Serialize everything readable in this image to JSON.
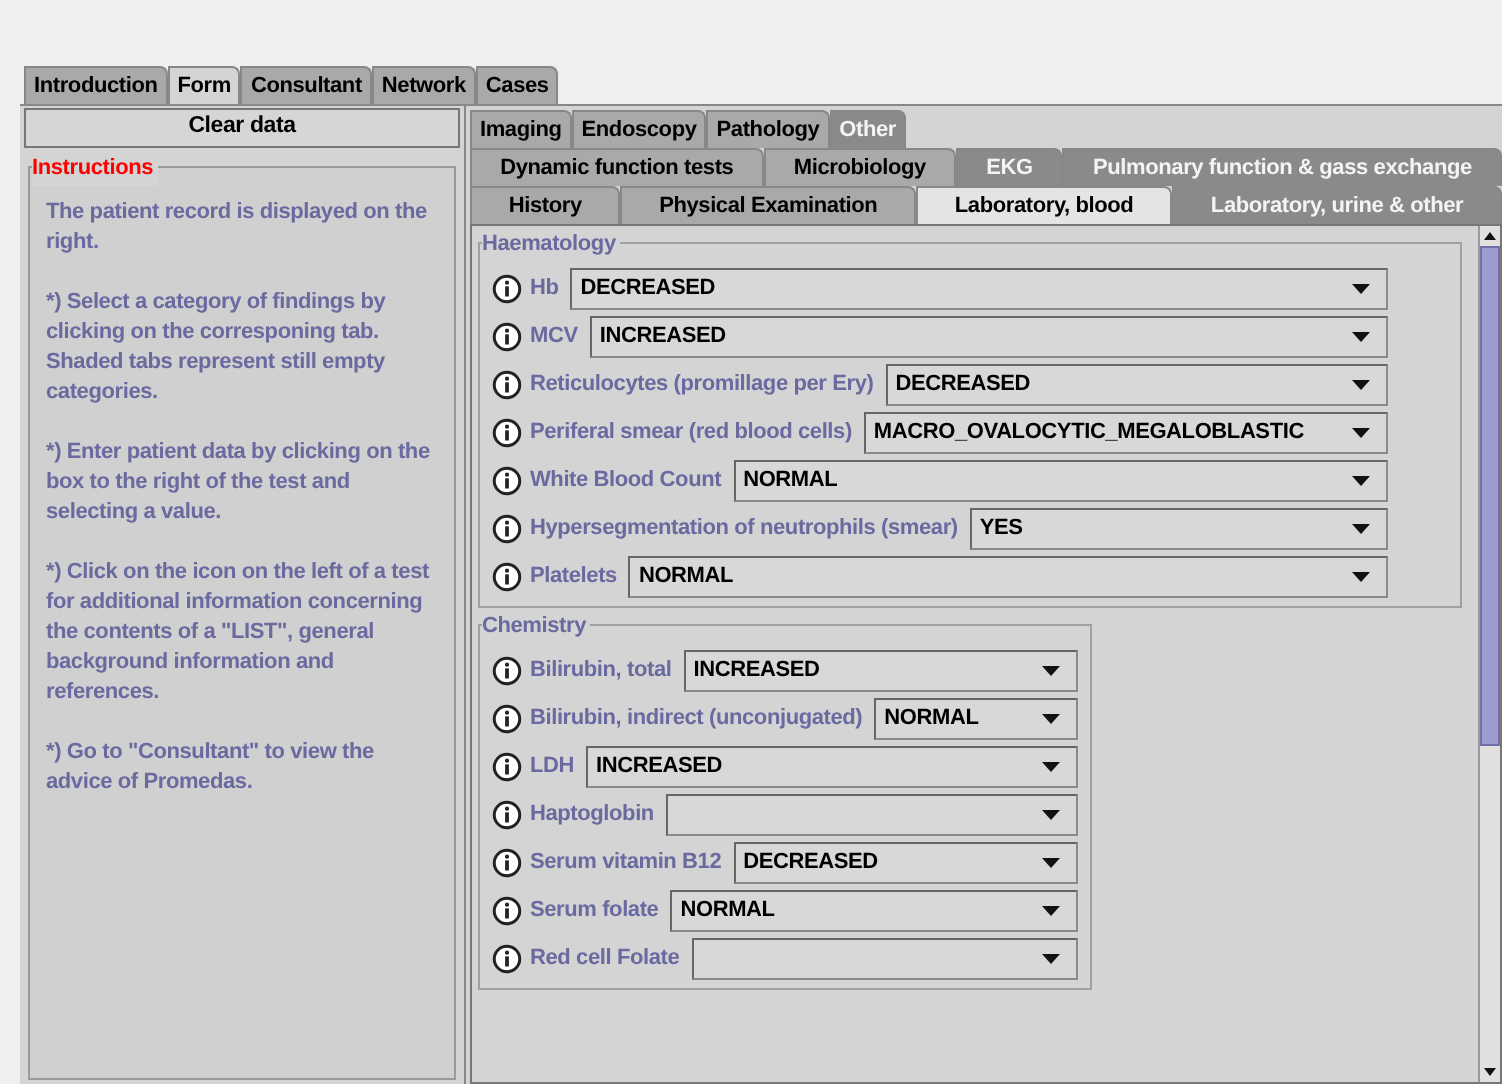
{
  "main_tabs": [
    {
      "label": "Introduction",
      "selected": false
    },
    {
      "label": "Form",
      "selected": true
    },
    {
      "label": "Consultant",
      "selected": false
    },
    {
      "label": "Network",
      "selected": false
    },
    {
      "label": "Cases",
      "selected": false
    }
  ],
  "clear_button": "Clear data",
  "instructions": {
    "title": "Instructions",
    "paragraphs": [
      "The patient record is displayed on the right.",
      "*) Select a category of findings by clicking on the corresponing tab. Shaded tabs represent still empty categories.",
      "*) Enter patient data by clicking on the box to the right of the test and selecting a value.",
      "*) Click on the icon on the left of a test for additional information concerning the contents of a \"LIST\", general background information and references.",
      "*) Go to \"Consultant\" to view the advice of Promedas."
    ]
  },
  "category_tab_rows": [
    [
      {
        "label": "Imaging",
        "selected": false,
        "disabled": false
      },
      {
        "label": "Endoscopy",
        "selected": false,
        "disabled": false
      },
      {
        "label": "Pathology",
        "selected": false,
        "disabled": false
      },
      {
        "label": "Other",
        "selected": false,
        "disabled": true
      }
    ],
    [
      {
        "label": "Dynamic function tests",
        "selected": false,
        "disabled": false
      },
      {
        "label": "Microbiology",
        "selected": false,
        "disabled": false
      },
      {
        "label": "EKG",
        "selected": false,
        "disabled": true
      },
      {
        "label": "Pulmonary function & gass exchange",
        "selected": false,
        "disabled": true
      }
    ],
    [
      {
        "label": "History",
        "selected": false,
        "disabled": false
      },
      {
        "label": "Physical Examination",
        "selected": false,
        "disabled": false
      },
      {
        "label": "Laboratory, blood",
        "selected": true,
        "disabled": false
      },
      {
        "label": "Laboratory, urine & other",
        "selected": false,
        "disabled": true
      }
    ]
  ],
  "sections": [
    {
      "title": "Haematology",
      "rows": [
        {
          "label": "Hb",
          "value": "DECREASED"
        },
        {
          "label": "MCV",
          "value": "INCREASED"
        },
        {
          "label": "Reticulocytes (promillage per Ery)",
          "value": "DECREASED"
        },
        {
          "label": "Periferal smear (red blood cells)",
          "value": "MACRO_OVALOCYTIC_MEGALOBLASTIC"
        },
        {
          "label": "White Blood Count",
          "value": "NORMAL"
        },
        {
          "label": "Hypersegmentation of neutrophils (smear)",
          "value": "YES"
        },
        {
          "label": "Platelets",
          "value": "NORMAL"
        }
      ]
    },
    {
      "title": "Chemistry",
      "rows": [
        {
          "label": "Bilirubin, total",
          "value": "INCREASED"
        },
        {
          "label": "Bilirubin, indirect (unconjugated)",
          "value": "NORMAL"
        },
        {
          "label": "LDH",
          "value": "INCREASED"
        },
        {
          "label": "Haptoglobin"
        },
        {
          "label": "Serum vitamin B12",
          "value": "DECREASED"
        },
        {
          "label": "Serum folate",
          "value": "NORMAL"
        },
        {
          "label": "Red cell Folate"
        }
      ]
    }
  ]
}
